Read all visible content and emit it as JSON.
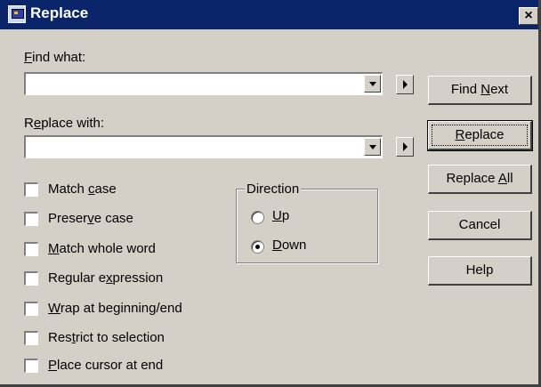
{
  "window": {
    "title": "Replace",
    "close_glyph": "×",
    "app_icon": "replace-dialog-icon"
  },
  "find": {
    "label_accel": "F",
    "label_rest": "ind what:",
    "value": ""
  },
  "replace": {
    "label_pre": "R",
    "label_accel": "e",
    "label_rest": "place with:",
    "value": ""
  },
  "buttons": {
    "find_next_pre": "Find ",
    "find_next_accel": "N",
    "find_next_post": "ext",
    "replace_accel": "R",
    "replace_post": "eplace",
    "replace_all_pre": "Replace ",
    "replace_all_accel": "A",
    "replace_all_post": "ll",
    "cancel": "Cancel",
    "help": "Help"
  },
  "options": [
    {
      "pre": "Match ",
      "accel": "c",
      "post": "ase",
      "checked": false
    },
    {
      "pre": "Preser",
      "accel": "v",
      "post": "e case",
      "checked": false
    },
    {
      "pre": "",
      "accel": "M",
      "post": "atch whole word",
      "checked": false
    },
    {
      "pre": "Regular e",
      "accel": "x",
      "post": "pression",
      "checked": false
    },
    {
      "pre": "",
      "accel": "W",
      "post": "rap at beginning/end",
      "checked": false
    },
    {
      "pre": "Res",
      "accel": "t",
      "post": "rict to selection",
      "checked": false
    },
    {
      "pre": "",
      "accel": "P",
      "post": "lace cursor at end",
      "checked": false
    }
  ],
  "direction": {
    "title": "Direction",
    "up_accel": "U",
    "up_rest": "p",
    "down_accel": "D",
    "down_rest": "own",
    "selected": "Down"
  }
}
